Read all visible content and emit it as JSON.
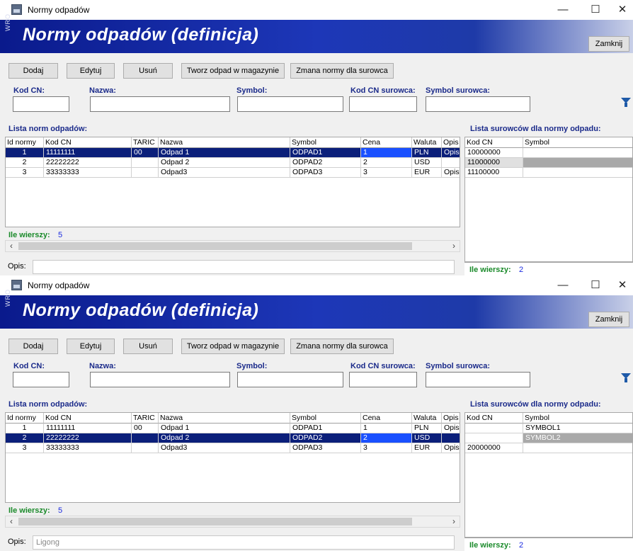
{
  "windows": [
    {
      "title": "Normy odpadów",
      "banner_side": "WRO",
      "banner_title": "Normy odpadów (definicja)",
      "close_label": "Zamknij",
      "toolbar": [
        "Dodaj",
        "Edytuj",
        "Usuń",
        "Tworz odpad w magazynie",
        "Zmana normy dla surowca"
      ],
      "filters": {
        "kod_cn": "Kod CN:",
        "nazwa": "Nazwa:",
        "symbol": "Symbol:",
        "kod_cn_surowca": "Kod CN surowca:",
        "symbol_surowca": "Symbol surowca:"
      },
      "left_title": "Lista norm odpadów:",
      "right_title": "Lista surowców dla normy odpadu:",
      "left_columns": [
        "Id normy",
        "Kod CN",
        "TARIC",
        "Nazwa",
        "Symbol",
        "Cena",
        "Waluta",
        "Opis"
      ],
      "left_rows": [
        [
          "1",
          "11111111",
          "00",
          "Odpad 1",
          "ODPAD1",
          "1",
          "PLN",
          "Opis"
        ],
        [
          "2",
          "22222222",
          "",
          "Odpad 2",
          "ODPAD2",
          "2",
          "USD",
          ""
        ],
        [
          "3",
          "33333333",
          "",
          "Odpad3",
          "ODPAD3",
          "3",
          "EUR",
          "Opis"
        ]
      ],
      "left_selected": 0,
      "right_columns": [
        "Kod CN",
        "Symbol"
      ],
      "right_rows": [
        [
          "10000000",
          ""
        ],
        [
          "11000000",
          ""
        ],
        [
          "11100000",
          ""
        ]
      ],
      "right_selected": 1,
      "count_label": "Ile wierszy:",
      "left_count": "5",
      "right_count": "2",
      "opis_label": "Opis:",
      "opis_value": ""
    },
    {
      "title": "Normy odpadów",
      "banner_side": "WRO",
      "banner_title": "Normy odpadów (definicja)",
      "close_label": "Zamknij",
      "toolbar": [
        "Dodaj",
        "Edytuj",
        "Usuń",
        "Tworz odpad w magazynie",
        "Zmana normy dla surowca"
      ],
      "filters": {
        "kod_cn": "Kod CN:",
        "nazwa": "Nazwa:",
        "symbol": "Symbol:",
        "kod_cn_surowca": "Kod CN surowca:",
        "symbol_surowca": "Symbol surowca:"
      },
      "left_title": "Lista norm odpadów:",
      "right_title": "Lista surowców dla normy odpadu:",
      "left_columns": [
        "Id normy",
        "Kod CN",
        "TARIC",
        "Nazwa",
        "Symbol",
        "Cena",
        "Waluta",
        "Opis"
      ],
      "left_rows": [
        [
          "1",
          "11111111",
          "00",
          "Odpad 1",
          "ODPAD1",
          "1",
          "PLN",
          "Opis"
        ],
        [
          "2",
          "22222222",
          "",
          "Odpad 2",
          "ODPAD2",
          "2",
          "USD",
          ""
        ],
        [
          "3",
          "33333333",
          "",
          "Odpad3",
          "ODPAD3",
          "3",
          "EUR",
          "Opis"
        ]
      ],
      "left_selected": 1,
      "right_columns": [
        "Kod CN",
        "Symbol"
      ],
      "right_rows": [
        [
          "",
          "SYMBOL1"
        ],
        [
          "",
          "SYMBOL2"
        ],
        [
          "20000000",
          ""
        ]
      ],
      "right_selected": 1,
      "count_label": "Ile wierszy:",
      "left_count": "5",
      "right_count": "2",
      "opis_label": "Opis:",
      "opis_value": "Ligong"
    }
  ]
}
